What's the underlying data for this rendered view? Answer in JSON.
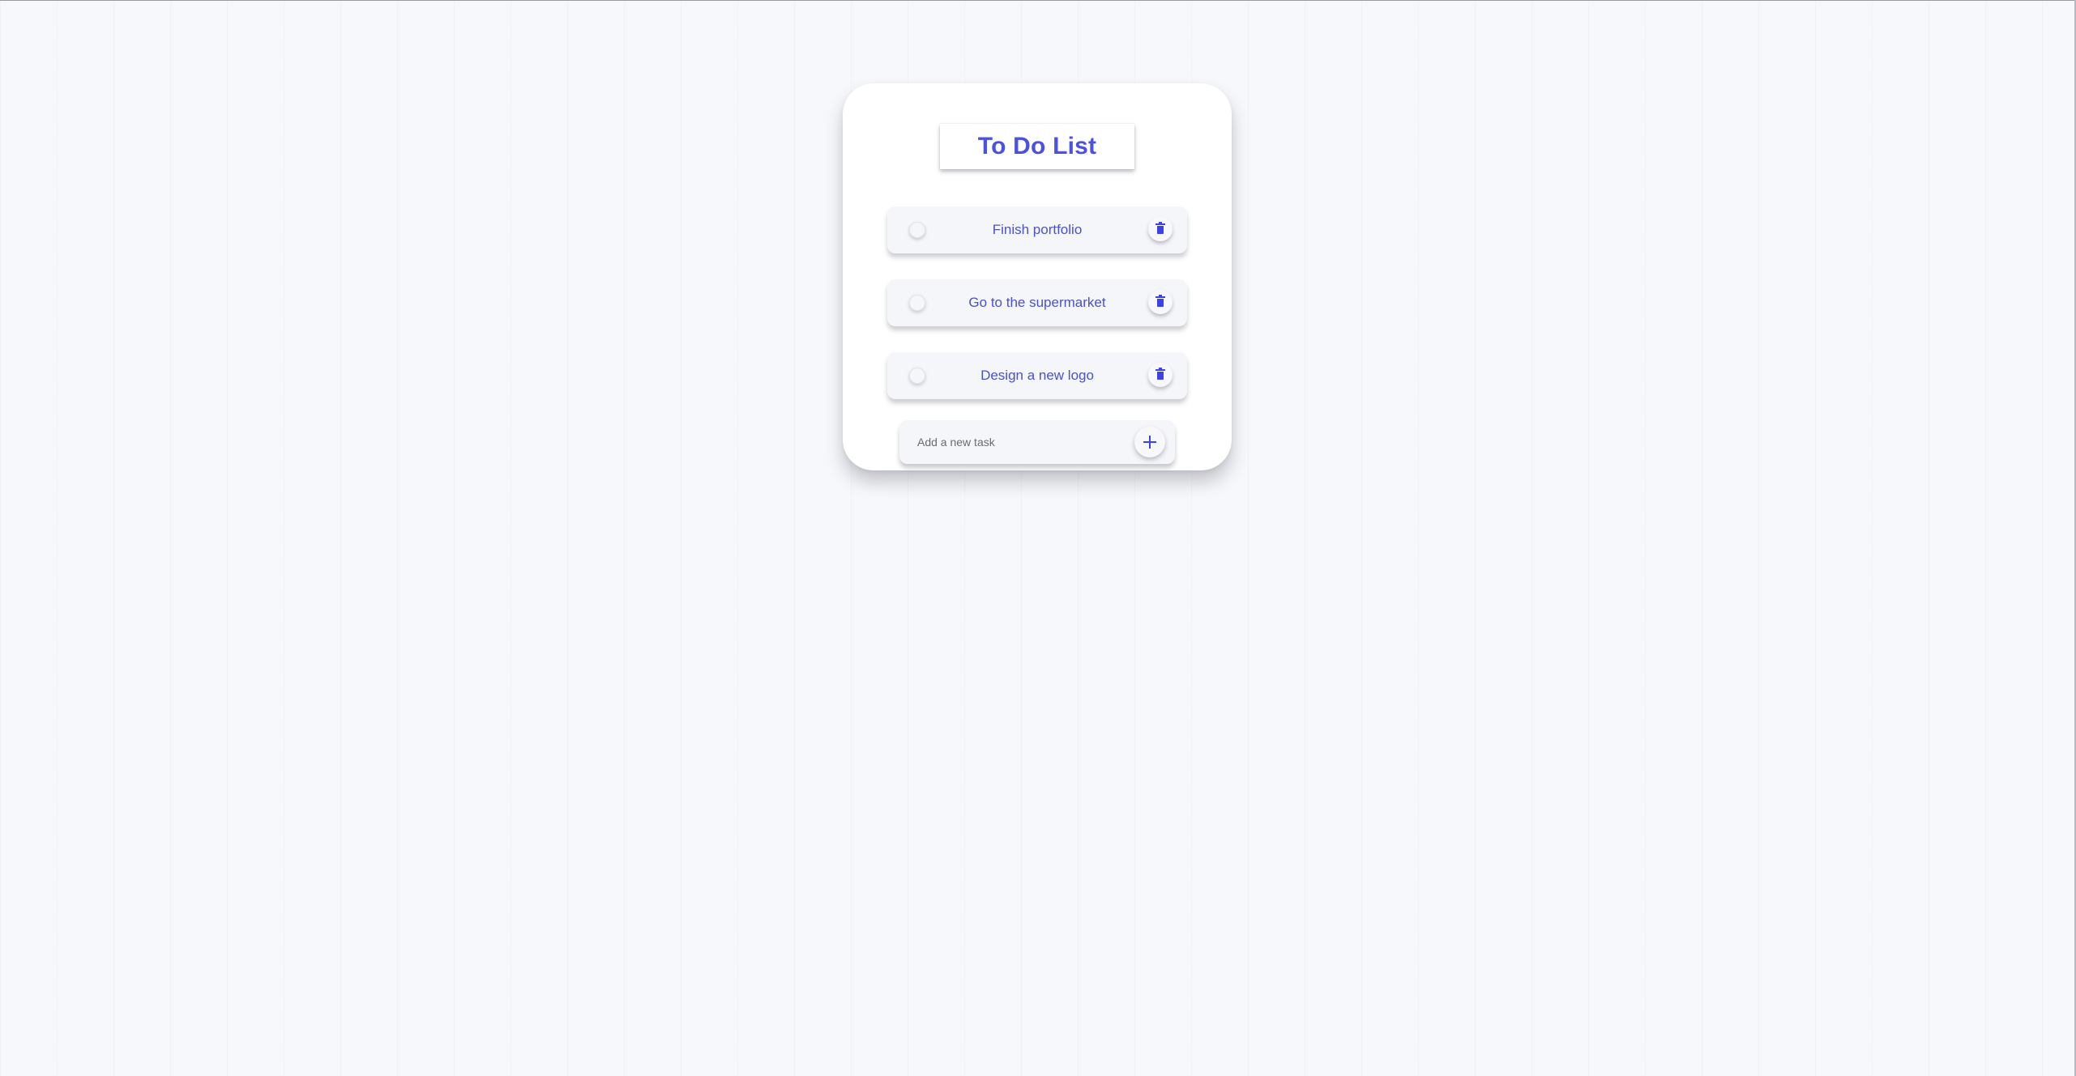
{
  "app": {
    "title": "To Do List"
  },
  "tasks": [
    {
      "label": "Finish portfolio",
      "completed": false
    },
    {
      "label": "Go to the supermarket",
      "completed": false
    },
    {
      "label": "Design a new logo",
      "completed": false
    }
  ],
  "add_task": {
    "placeholder": "Add a new task",
    "value": ""
  },
  "icons": {
    "task_toggle": "circle-checkbox-icon",
    "task_delete": "trash-icon",
    "add": "plus-icon"
  },
  "colors": {
    "accent": "#4b51e0",
    "icon": "#3b43e6",
    "card": "#ffffff",
    "task_bg": "#f5f6fa",
    "page_bg": "#f7f8fb"
  }
}
